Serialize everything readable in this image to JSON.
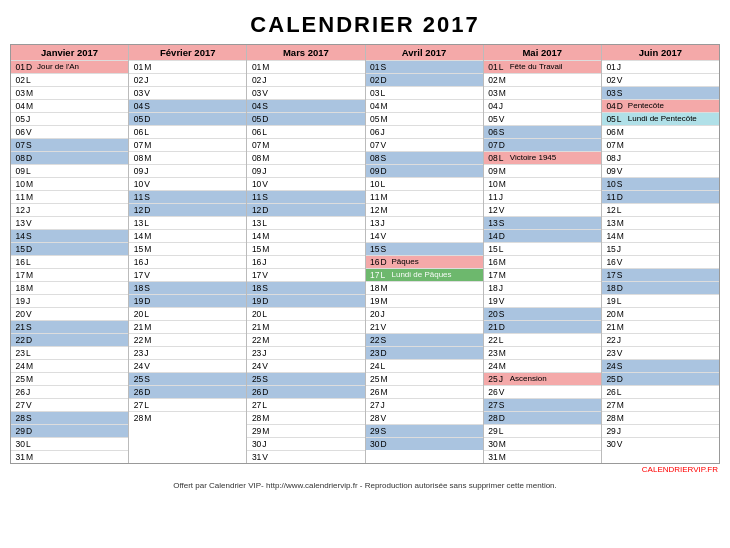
{
  "title": "CALENDRIER 2017",
  "footer_brand": "CALENDRIERVIP.FR",
  "footer_note": "Offert par Calendrier VIP- http://www.calendriervip.fr - Reproduction autorisée sans supprimer cette mention.",
  "months": [
    {
      "name": "Janvier 2017",
      "days": [
        {
          "n": "01",
          "l": "D",
          "label": "Jour de l'An",
          "bg": "bg-red"
        },
        {
          "n": "02",
          "l": "L",
          "label": "",
          "bg": ""
        },
        {
          "n": "03",
          "l": "M",
          "label": "",
          "bg": ""
        },
        {
          "n": "04",
          "l": "M",
          "label": "",
          "bg": ""
        },
        {
          "n": "05",
          "l": "J",
          "label": "",
          "bg": ""
        },
        {
          "n": "06",
          "l": "V",
          "label": "",
          "bg": ""
        },
        {
          "n": "07",
          "l": "S",
          "label": "",
          "bg": "bg-blue"
        },
        {
          "n": "08",
          "l": "D",
          "label": "",
          "bg": "bg-blue"
        },
        {
          "n": "09",
          "l": "L",
          "label": "",
          "bg": ""
        },
        {
          "n": "10",
          "l": "M",
          "label": "",
          "bg": ""
        },
        {
          "n": "11",
          "l": "M",
          "label": "",
          "bg": ""
        },
        {
          "n": "12",
          "l": "J",
          "label": "",
          "bg": ""
        },
        {
          "n": "13",
          "l": "V",
          "label": "",
          "bg": ""
        },
        {
          "n": "14",
          "l": "S",
          "label": "",
          "bg": "bg-blue"
        },
        {
          "n": "15",
          "l": "D",
          "label": "",
          "bg": "bg-blue"
        },
        {
          "n": "16",
          "l": "L",
          "label": "",
          "bg": ""
        },
        {
          "n": "17",
          "l": "M",
          "label": "",
          "bg": ""
        },
        {
          "n": "18",
          "l": "M",
          "label": "",
          "bg": ""
        },
        {
          "n": "19",
          "l": "J",
          "label": "",
          "bg": ""
        },
        {
          "n": "20",
          "l": "V",
          "label": "",
          "bg": ""
        },
        {
          "n": "21",
          "l": "S",
          "label": "",
          "bg": "bg-blue"
        },
        {
          "n": "22",
          "l": "D",
          "label": "",
          "bg": "bg-blue"
        },
        {
          "n": "23",
          "l": "L",
          "label": "",
          "bg": ""
        },
        {
          "n": "24",
          "l": "M",
          "label": "",
          "bg": ""
        },
        {
          "n": "25",
          "l": "M",
          "label": "",
          "bg": ""
        },
        {
          "n": "26",
          "l": "J",
          "label": "",
          "bg": ""
        },
        {
          "n": "27",
          "l": "V",
          "label": "",
          "bg": ""
        },
        {
          "n": "28",
          "l": "S",
          "label": "",
          "bg": "bg-blue"
        },
        {
          "n": "29",
          "l": "D",
          "label": "",
          "bg": "bg-blue"
        },
        {
          "n": "30",
          "l": "L",
          "label": "",
          "bg": ""
        },
        {
          "n": "31",
          "l": "M",
          "label": "",
          "bg": ""
        }
      ]
    },
    {
      "name": "Février 2017",
      "days": [
        {
          "n": "01",
          "l": "M",
          "label": "",
          "bg": ""
        },
        {
          "n": "02",
          "l": "J",
          "label": "",
          "bg": ""
        },
        {
          "n": "03",
          "l": "V",
          "label": "",
          "bg": ""
        },
        {
          "n": "04",
          "l": "S",
          "label": "",
          "bg": "bg-blue"
        },
        {
          "n": "05",
          "l": "D",
          "label": "",
          "bg": "bg-blue"
        },
        {
          "n": "06",
          "l": "L",
          "label": "",
          "bg": ""
        },
        {
          "n": "07",
          "l": "M",
          "label": "",
          "bg": ""
        },
        {
          "n": "08",
          "l": "M",
          "label": "",
          "bg": ""
        },
        {
          "n": "09",
          "l": "J",
          "label": "",
          "bg": ""
        },
        {
          "n": "10",
          "l": "V",
          "label": "",
          "bg": ""
        },
        {
          "n": "11",
          "l": "S",
          "label": "",
          "bg": "bg-blue"
        },
        {
          "n": "12",
          "l": "D",
          "label": "",
          "bg": "bg-blue"
        },
        {
          "n": "13",
          "l": "L",
          "label": "",
          "bg": ""
        },
        {
          "n": "14",
          "l": "M",
          "label": "",
          "bg": ""
        },
        {
          "n": "15",
          "l": "M",
          "label": "",
          "bg": ""
        },
        {
          "n": "16",
          "l": "J",
          "label": "",
          "bg": ""
        },
        {
          "n": "17",
          "l": "V",
          "label": "",
          "bg": ""
        },
        {
          "n": "18",
          "l": "S",
          "label": "",
          "bg": "bg-blue"
        },
        {
          "n": "19",
          "l": "D",
          "label": "",
          "bg": "bg-blue"
        },
        {
          "n": "20",
          "l": "L",
          "label": "",
          "bg": ""
        },
        {
          "n": "21",
          "l": "M",
          "label": "",
          "bg": ""
        },
        {
          "n": "22",
          "l": "M",
          "label": "",
          "bg": ""
        },
        {
          "n": "23",
          "l": "J",
          "label": "",
          "bg": ""
        },
        {
          "n": "24",
          "l": "V",
          "label": "",
          "bg": ""
        },
        {
          "n": "25",
          "l": "S",
          "label": "",
          "bg": "bg-blue"
        },
        {
          "n": "26",
          "l": "D",
          "label": "",
          "bg": "bg-blue"
        },
        {
          "n": "27",
          "l": "L",
          "label": "",
          "bg": ""
        },
        {
          "n": "28",
          "l": "M",
          "label": "",
          "bg": ""
        }
      ]
    },
    {
      "name": "Mars 2017",
      "days": [
        {
          "n": "01",
          "l": "M",
          "label": "",
          "bg": ""
        },
        {
          "n": "02",
          "l": "J",
          "label": "",
          "bg": ""
        },
        {
          "n": "03",
          "l": "V",
          "label": "",
          "bg": ""
        },
        {
          "n": "04",
          "l": "S",
          "label": "",
          "bg": "bg-blue"
        },
        {
          "n": "05",
          "l": "D",
          "label": "",
          "bg": "bg-blue"
        },
        {
          "n": "06",
          "l": "L",
          "label": "",
          "bg": ""
        },
        {
          "n": "07",
          "l": "M",
          "label": "",
          "bg": ""
        },
        {
          "n": "08",
          "l": "M",
          "label": "",
          "bg": ""
        },
        {
          "n": "09",
          "l": "J",
          "label": "",
          "bg": ""
        },
        {
          "n": "10",
          "l": "V",
          "label": "",
          "bg": ""
        },
        {
          "n": "11",
          "l": "S",
          "label": "",
          "bg": "bg-blue"
        },
        {
          "n": "12",
          "l": "D",
          "label": "",
          "bg": "bg-blue"
        },
        {
          "n": "13",
          "l": "L",
          "label": "",
          "bg": ""
        },
        {
          "n": "14",
          "l": "M",
          "label": "",
          "bg": ""
        },
        {
          "n": "15",
          "l": "M",
          "label": "",
          "bg": ""
        },
        {
          "n": "16",
          "l": "J",
          "label": "",
          "bg": ""
        },
        {
          "n": "17",
          "l": "V",
          "label": "",
          "bg": ""
        },
        {
          "n": "18",
          "l": "S",
          "label": "",
          "bg": "bg-blue"
        },
        {
          "n": "19",
          "l": "D",
          "label": "",
          "bg": "bg-blue"
        },
        {
          "n": "20",
          "l": "L",
          "label": "",
          "bg": ""
        },
        {
          "n": "21",
          "l": "M",
          "label": "",
          "bg": ""
        },
        {
          "n": "22",
          "l": "M",
          "label": "",
          "bg": ""
        },
        {
          "n": "23",
          "l": "J",
          "label": "",
          "bg": ""
        },
        {
          "n": "24",
          "l": "V",
          "label": "",
          "bg": ""
        },
        {
          "n": "25",
          "l": "S",
          "label": "",
          "bg": "bg-blue"
        },
        {
          "n": "26",
          "l": "D",
          "label": "",
          "bg": "bg-blue"
        },
        {
          "n": "27",
          "l": "L",
          "label": "",
          "bg": ""
        },
        {
          "n": "28",
          "l": "M",
          "label": "",
          "bg": ""
        },
        {
          "n": "29",
          "l": "M",
          "label": "",
          "bg": ""
        },
        {
          "n": "30",
          "l": "J",
          "label": "",
          "bg": ""
        },
        {
          "n": "31",
          "l": "V",
          "label": "",
          "bg": ""
        }
      ]
    },
    {
      "name": "Avril 2017",
      "days": [
        {
          "n": "01",
          "l": "S",
          "label": "",
          "bg": "bg-blue"
        },
        {
          "n": "02",
          "l": "D",
          "label": "",
          "bg": "bg-blue"
        },
        {
          "n": "03",
          "l": "L",
          "label": "",
          "bg": ""
        },
        {
          "n": "04",
          "l": "M",
          "label": "",
          "bg": ""
        },
        {
          "n": "05",
          "l": "M",
          "label": "",
          "bg": ""
        },
        {
          "n": "06",
          "l": "J",
          "label": "",
          "bg": ""
        },
        {
          "n": "07",
          "l": "V",
          "label": "",
          "bg": ""
        },
        {
          "n": "08",
          "l": "S",
          "label": "",
          "bg": "bg-blue"
        },
        {
          "n": "09",
          "l": "D",
          "label": "",
          "bg": "bg-blue"
        },
        {
          "n": "10",
          "l": "L",
          "label": "",
          "bg": ""
        },
        {
          "n": "11",
          "l": "M",
          "label": "",
          "bg": ""
        },
        {
          "n": "12",
          "l": "M",
          "label": "",
          "bg": ""
        },
        {
          "n": "13",
          "l": "J",
          "label": "",
          "bg": ""
        },
        {
          "n": "14",
          "l": "V",
          "label": "",
          "bg": ""
        },
        {
          "n": "15",
          "l": "S",
          "label": "",
          "bg": "bg-blue"
        },
        {
          "n": "16",
          "l": "D",
          "label": "Pâques",
          "bg": "bg-red"
        },
        {
          "n": "17",
          "l": "L",
          "label": "Lundi de Pâques",
          "bg": "bg-green"
        },
        {
          "n": "18",
          "l": "M",
          "label": "",
          "bg": ""
        },
        {
          "n": "19",
          "l": "M",
          "label": "",
          "bg": ""
        },
        {
          "n": "20",
          "l": "J",
          "label": "",
          "bg": ""
        },
        {
          "n": "21",
          "l": "V",
          "label": "",
          "bg": ""
        },
        {
          "n": "22",
          "l": "S",
          "label": "",
          "bg": "bg-blue"
        },
        {
          "n": "23",
          "l": "D",
          "label": "",
          "bg": "bg-blue"
        },
        {
          "n": "24",
          "l": "L",
          "label": "",
          "bg": ""
        },
        {
          "n": "25",
          "l": "M",
          "label": "",
          "bg": ""
        },
        {
          "n": "26",
          "l": "M",
          "label": "",
          "bg": ""
        },
        {
          "n": "27",
          "l": "J",
          "label": "",
          "bg": ""
        },
        {
          "n": "28",
          "l": "V",
          "label": "",
          "bg": ""
        },
        {
          "n": "29",
          "l": "S",
          "label": "",
          "bg": "bg-blue"
        },
        {
          "n": "30",
          "l": "D",
          "label": "",
          "bg": "bg-blue"
        }
      ]
    },
    {
      "name": "Mai 2017",
      "days": [
        {
          "n": "01",
          "l": "L",
          "label": "Fête du Travail",
          "bg": "bg-red"
        },
        {
          "n": "02",
          "l": "M",
          "label": "",
          "bg": ""
        },
        {
          "n": "03",
          "l": "M",
          "label": "",
          "bg": ""
        },
        {
          "n": "04",
          "l": "J",
          "label": "",
          "bg": ""
        },
        {
          "n": "05",
          "l": "V",
          "label": "",
          "bg": ""
        },
        {
          "n": "06",
          "l": "S",
          "label": "",
          "bg": "bg-blue"
        },
        {
          "n": "07",
          "l": "D",
          "label": "",
          "bg": "bg-blue"
        },
        {
          "n": "08",
          "l": "L",
          "label": "Victoire 1945",
          "bg": "bg-red"
        },
        {
          "n": "09",
          "l": "M",
          "label": "",
          "bg": ""
        },
        {
          "n": "10",
          "l": "M",
          "label": "",
          "bg": ""
        },
        {
          "n": "11",
          "l": "J",
          "label": "",
          "bg": ""
        },
        {
          "n": "12",
          "l": "V",
          "label": "",
          "bg": ""
        },
        {
          "n": "13",
          "l": "S",
          "label": "",
          "bg": "bg-blue"
        },
        {
          "n": "14",
          "l": "D",
          "label": "",
          "bg": "bg-blue"
        },
        {
          "n": "15",
          "l": "L",
          "label": "",
          "bg": ""
        },
        {
          "n": "16",
          "l": "M",
          "label": "",
          "bg": ""
        },
        {
          "n": "17",
          "l": "M",
          "label": "",
          "bg": ""
        },
        {
          "n": "18",
          "l": "J",
          "label": "",
          "bg": ""
        },
        {
          "n": "19",
          "l": "V",
          "label": "",
          "bg": ""
        },
        {
          "n": "20",
          "l": "S",
          "label": "",
          "bg": "bg-blue"
        },
        {
          "n": "21",
          "l": "D",
          "label": "",
          "bg": "bg-blue"
        },
        {
          "n": "22",
          "l": "L",
          "label": "",
          "bg": ""
        },
        {
          "n": "23",
          "l": "M",
          "label": "",
          "bg": ""
        },
        {
          "n": "24",
          "l": "M",
          "label": "",
          "bg": ""
        },
        {
          "n": "25",
          "l": "J",
          "label": "Ascension",
          "bg": "bg-red"
        },
        {
          "n": "26",
          "l": "V",
          "label": "",
          "bg": ""
        },
        {
          "n": "27",
          "l": "S",
          "label": "",
          "bg": "bg-blue"
        },
        {
          "n": "28",
          "l": "D",
          "label": "",
          "bg": "bg-blue"
        },
        {
          "n": "29",
          "l": "L",
          "label": "",
          "bg": ""
        },
        {
          "n": "30",
          "l": "M",
          "label": "",
          "bg": ""
        },
        {
          "n": "31",
          "l": "M",
          "label": "",
          "bg": ""
        }
      ]
    },
    {
      "name": "Juin 2017",
      "days": [
        {
          "n": "01",
          "l": "J",
          "label": "",
          "bg": ""
        },
        {
          "n": "02",
          "l": "V",
          "label": "",
          "bg": ""
        },
        {
          "n": "03",
          "l": "S",
          "label": "",
          "bg": "bg-blue"
        },
        {
          "n": "04",
          "l": "D",
          "label": "Pentecôte",
          "bg": "bg-red"
        },
        {
          "n": "05",
          "l": "L",
          "label": "Lundi de Pentecôte",
          "bg": "bg-cyan"
        },
        {
          "n": "06",
          "l": "M",
          "label": "",
          "bg": ""
        },
        {
          "n": "07",
          "l": "M",
          "label": "",
          "bg": ""
        },
        {
          "n": "08",
          "l": "J",
          "label": "",
          "bg": ""
        },
        {
          "n": "09",
          "l": "V",
          "label": "",
          "bg": ""
        },
        {
          "n": "10",
          "l": "S",
          "label": "",
          "bg": "bg-blue"
        },
        {
          "n": "11",
          "l": "D",
          "label": "",
          "bg": "bg-blue"
        },
        {
          "n": "12",
          "l": "L",
          "label": "",
          "bg": ""
        },
        {
          "n": "13",
          "l": "M",
          "label": "",
          "bg": ""
        },
        {
          "n": "14",
          "l": "M",
          "label": "",
          "bg": ""
        },
        {
          "n": "15",
          "l": "J",
          "label": "",
          "bg": ""
        },
        {
          "n": "16",
          "l": "V",
          "label": "",
          "bg": ""
        },
        {
          "n": "17",
          "l": "S",
          "label": "",
          "bg": "bg-blue"
        },
        {
          "n": "18",
          "l": "D",
          "label": "",
          "bg": "bg-blue"
        },
        {
          "n": "19",
          "l": "L",
          "label": "",
          "bg": ""
        },
        {
          "n": "20",
          "l": "M",
          "label": "",
          "bg": ""
        },
        {
          "n": "21",
          "l": "M",
          "label": "",
          "bg": ""
        },
        {
          "n": "22",
          "l": "J",
          "label": "",
          "bg": ""
        },
        {
          "n": "23",
          "l": "V",
          "label": "",
          "bg": ""
        },
        {
          "n": "24",
          "l": "S",
          "label": "",
          "bg": "bg-blue"
        },
        {
          "n": "25",
          "l": "D",
          "label": "",
          "bg": "bg-blue"
        },
        {
          "n": "26",
          "l": "L",
          "label": "",
          "bg": ""
        },
        {
          "n": "27",
          "l": "M",
          "label": "",
          "bg": ""
        },
        {
          "n": "28",
          "l": "M",
          "label": "",
          "bg": ""
        },
        {
          "n": "29",
          "l": "J",
          "label": "",
          "bg": ""
        },
        {
          "n": "30",
          "l": "V",
          "label": "",
          "bg": ""
        }
      ]
    }
  ]
}
